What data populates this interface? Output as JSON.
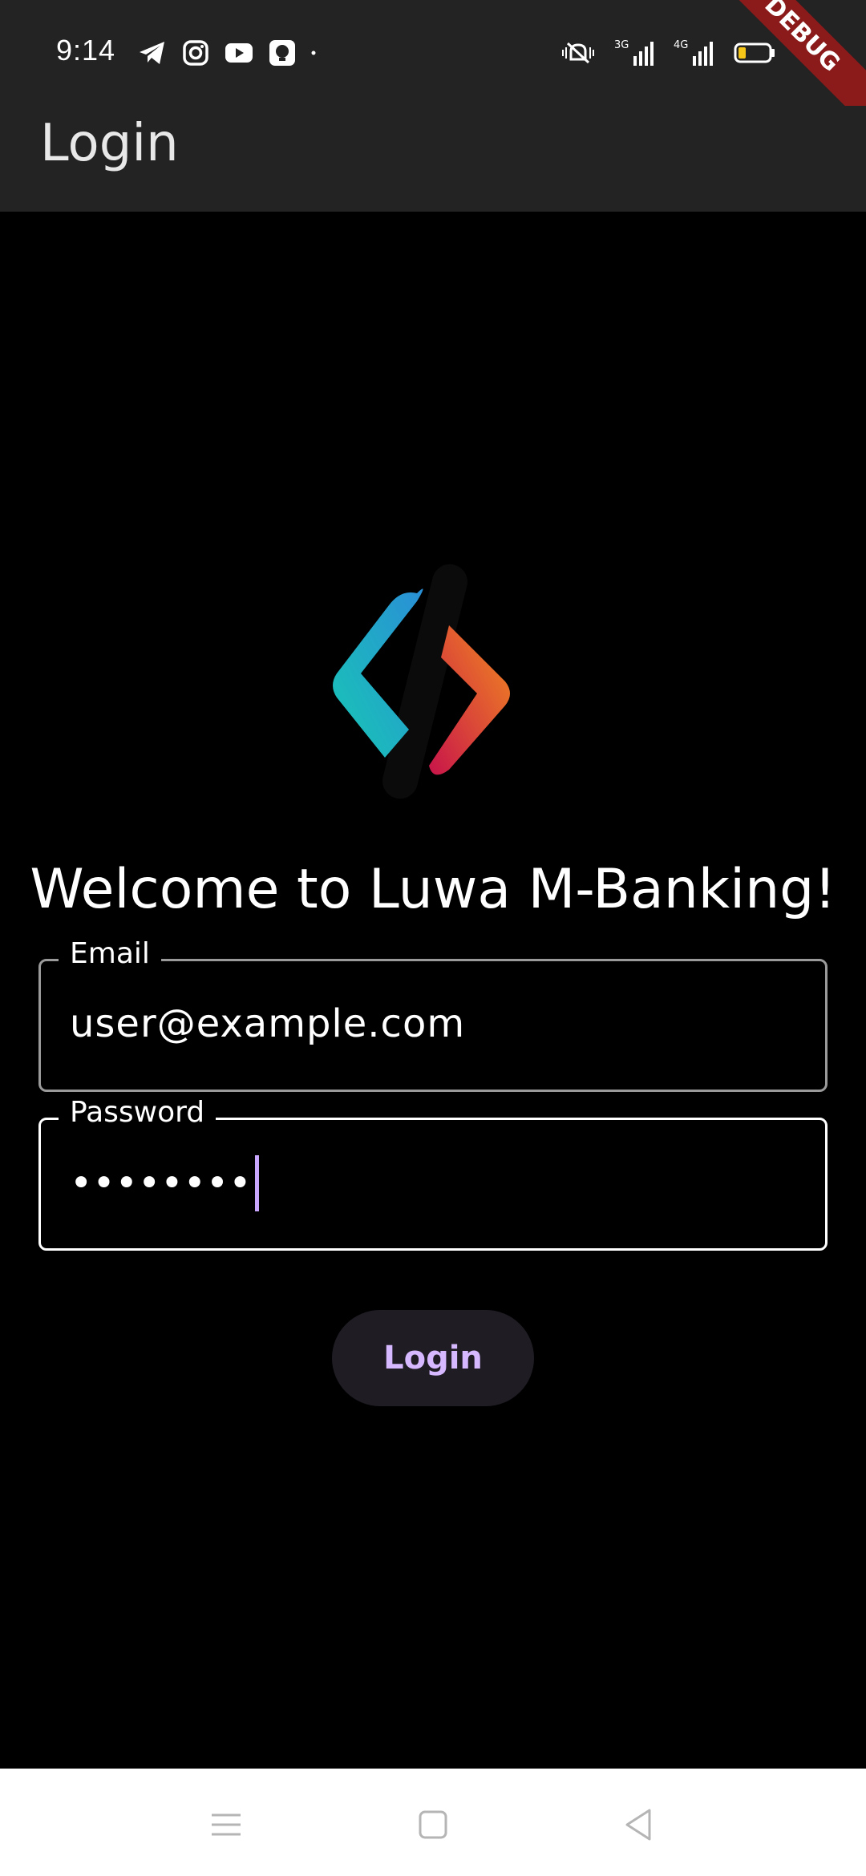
{
  "status_bar": {
    "time": "9:14",
    "left_icons": [
      "telegram-icon",
      "instagram-icon",
      "youtube-icon",
      "notification-app-icon",
      "dot-icon"
    ],
    "right_icons": [
      "silent-vibrate-icon",
      "signal-3g-icon",
      "signal-4g-icon",
      "battery-low-icon"
    ],
    "network_labels": [
      "3G",
      "4G"
    ]
  },
  "debug_banner": "DEBUG",
  "app_bar": {
    "title": "Login"
  },
  "main": {
    "logo": "luwa-logo",
    "welcome_text": "Welcome to Luwa M-Banking!",
    "email": {
      "label": "Email",
      "value": "user@example.com"
    },
    "password": {
      "label": "Password",
      "masked_value": "••••••••"
    },
    "login_button": "Login"
  },
  "nav_bar": {
    "items": [
      "menu-icon",
      "home-square-icon",
      "back-triangle-icon"
    ]
  },
  "colors": {
    "app_bar_bg": "#232323",
    "background": "#000000",
    "accent": "#d5b8ff",
    "debug_banner": "#8b1a1a"
  }
}
